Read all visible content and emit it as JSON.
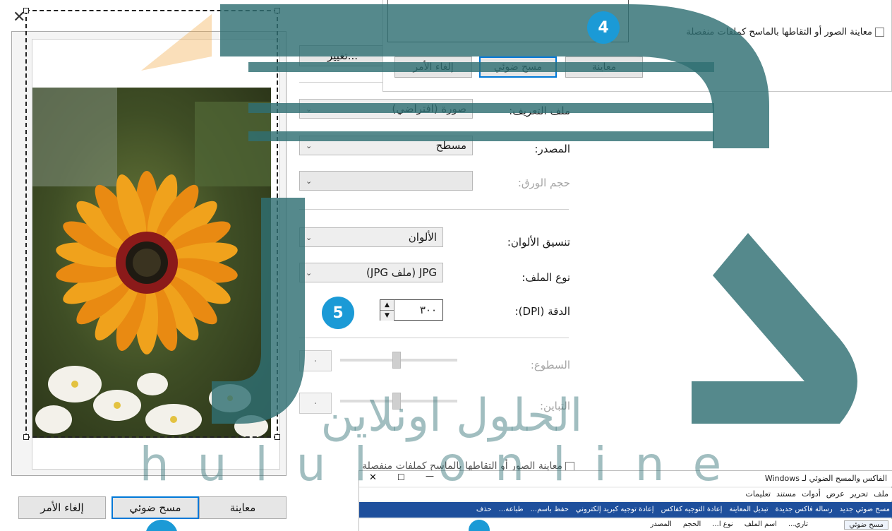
{
  "preview_dialog": {
    "close_glyph": "✕",
    "buttons": {
      "preview": "معاينة",
      "scan": "مسح ضوئي",
      "cancel": "إلغاء الأمر"
    }
  },
  "settings": {
    "change_button": "تغيير...",
    "profile": {
      "label": "ملف التعريف:",
      "value": "صورة (افتراضي)"
    },
    "source": {
      "label": "المصدر:",
      "value": "مسطح"
    },
    "paper_size": {
      "label": "حجم الورق:",
      "value": ""
    },
    "color_format": {
      "label": "تنسيق الألوان:",
      "value": "الألوان"
    },
    "file_type": {
      "label": "نوع الملف:",
      "value": "JPG (ملف JPG)"
    },
    "resolution": {
      "label": "الدقة (DPI):",
      "value": "٣٠٠"
    },
    "brightness": {
      "label": "السطوع:",
      "value": "٠"
    },
    "contrast": {
      "label": "التباين:",
      "value": "٠"
    },
    "separate_files_checkbox": "معاينة الصور أو التقاطها بالماسح كملفات منفصلة"
  },
  "top_popup": {
    "checkbox_label": "معاينة الصور أو التقاطها بالماسح كملفات منفصلة",
    "buttons": {
      "preview": "معاينة",
      "scan": "مسح ضوئي",
      "cancel": "إلغاء الأمر"
    }
  },
  "steps": {
    "step4": "4",
    "step5": "5"
  },
  "fax_app": {
    "title": "الفاكس والمسح الضوئي لـ Windows",
    "window_controls": {
      "close": "✕",
      "maximize": "☐",
      "minimize": "—"
    },
    "menu": [
      "ملف",
      "تحرير",
      "عرض",
      "أدوات",
      "مستند",
      "تعليمات"
    ],
    "toolbar": [
      "مسح ضوئي جديد",
      "رسالة فاكس جديدة",
      "تبديل المعاينة",
      "إعادة التوجيه كفاكس",
      "إعادة توجيه كبريد إلكتروني",
      "حفظ باسم...",
      "طباعة...",
      "حذف"
    ],
    "nav_item": "مسح ضوئي",
    "columns": [
      "تاري...",
      "اسم الملف",
      "نوع ا...",
      "الحجم",
      "المصدر"
    ]
  },
  "watermark": {
    "arabic": "الحلول اونلاين",
    "latin": "hulul online"
  },
  "colors": {
    "accent": "#1b9ad6",
    "watermark": "#2f6f73",
    "primary_border": "#0078d7"
  }
}
